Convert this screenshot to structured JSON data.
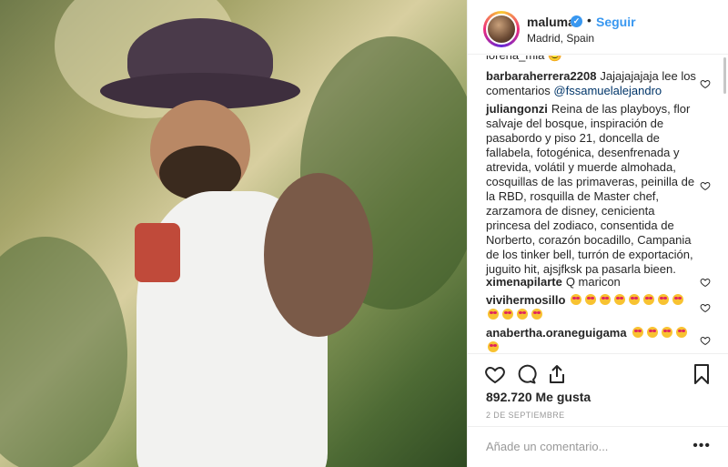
{
  "post": {
    "author": {
      "username": "maluma",
      "verified": true,
      "follow_label": "Seguir",
      "dot": "•",
      "location": "Madrid, Spain"
    },
    "partial_top": "lorena_mia 😊",
    "comments": [
      {
        "user": "barbaraherrera2208",
        "text": "Jajajajajaja lee los comentarios ",
        "mention": "@fssamuelalejandro"
      },
      {
        "user": "juliangonzi",
        "text": "Reina de las playboys, flor salvaje del bosque, inspiración de pasabordo y piso 21, doncella de fallabela, fotogénica, desenfrenada y atrevida, volátil y muerde almohada, cosquillas de las primaveras, peinilla de la RBD, rosquilla de Master chef, zarzamora de disney, cenicienta princesa del zodiaco, consentida de Norberto, corazón bocadillo, Campania de los tinker bell, turrón de exportación, juguito hit, ajsjfksk pa pasarla bieen."
      },
      {
        "user": "ximenapilarte",
        "text": "Q maricon"
      },
      {
        "user": "vivihermosillo",
        "emoji_count": 12
      },
      {
        "user": "anabertha.oraneguigama",
        "emoji_count": 5
      }
    ],
    "likes": "892.720 Me gusta",
    "date": "2 DE SEPTIEMBRE",
    "comment_placeholder": "Añade un comentario...",
    "more_label": "•••",
    "icons": [
      "heart-icon",
      "comment-icon",
      "share-icon",
      "bookmark-icon"
    ],
    "colors": {
      "link": "#3897f0",
      "text": "#262626",
      "muted": "#999999",
      "border": "#efefef"
    }
  }
}
